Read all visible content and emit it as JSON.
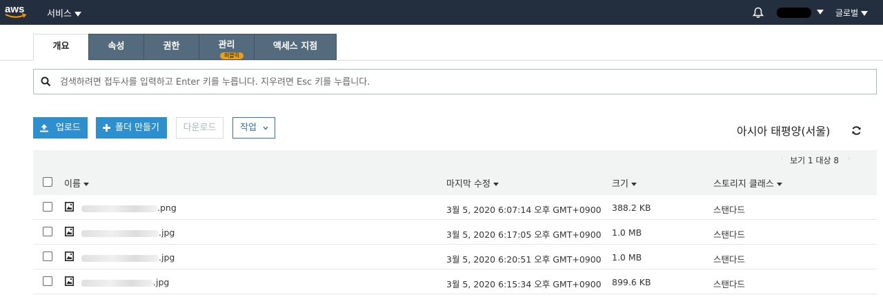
{
  "nav": {
    "logo_text": "aws",
    "services_label": "서비스",
    "global_label": "글로벌"
  },
  "tabs": [
    {
      "label": "개요",
      "active": true
    },
    {
      "label": "속성",
      "active": false
    },
    {
      "label": "권한",
      "active": false
    },
    {
      "label": "관리",
      "active": false,
      "badge": "퍼블릭"
    },
    {
      "label": "액세스 지점",
      "active": false
    }
  ],
  "search": {
    "placeholder": "검색하려면 접두사를 입력하고 Enter 키를 누릅니다. 지우려면 Esc 키를 누릅니다.",
    "value": ""
  },
  "actions": {
    "upload_label": "업로드",
    "create_folder_label": "폴더 만들기",
    "download_label": "다운로드",
    "actions_label": "작업"
  },
  "region": "아시아 태평양(서울)",
  "pager": "보기 1 대상 8",
  "table": {
    "headers": {
      "name": "이름",
      "last_modified": "마지막 수정",
      "size": "크기",
      "storage_class": "스토리지 클래스"
    },
    "rows": [
      {
        "name_suffix": ".png",
        "last_modified": "3월 5, 2020 6:07:14 오후 GMT+0900",
        "size": "388.2 KB",
        "storage_class": "스탠다드"
      },
      {
        "name_suffix": ".jpg",
        "last_modified": "3월 5, 2020 6:17:05 오후 GMT+0900",
        "size": "1.0 MB",
        "storage_class": "스탠다드"
      },
      {
        "name_suffix": ".jpg",
        "last_modified": "3월 5, 2020 6:20:51 오후 GMT+0900",
        "size": "1.0 MB",
        "storage_class": "스탠다드"
      },
      {
        "name_suffix": ".jpg",
        "last_modified": "3월 5, 2020 6:15:34 오후 GMT+0900",
        "size": "899.6 KB",
        "storage_class": "스탠다드"
      }
    ]
  },
  "colors": {
    "nav_bg": "#232f3e",
    "tab_bg": "#546b7d",
    "primary": "#2e8fcf",
    "badge": "#e6a01e",
    "logo_smile": "#ff9900"
  }
}
